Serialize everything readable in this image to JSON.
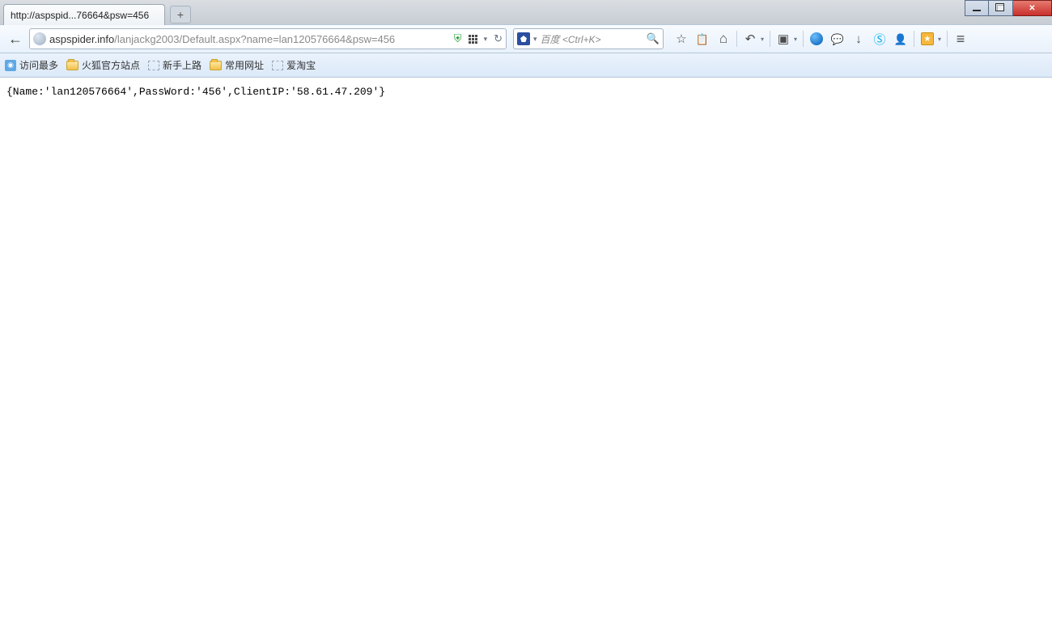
{
  "window": {
    "tab_title": "http://aspspid...76664&psw=456"
  },
  "url": {
    "host": "aspspider.info",
    "path": "/lanjackg2003/Default.aspx?name=lan120576664&psw=456"
  },
  "search": {
    "placeholder": "百度 <Ctrl+K>"
  },
  "bookmarks": {
    "items": [
      {
        "label": "访问最多",
        "icon": "feed"
      },
      {
        "label": "火狐官方站点",
        "icon": "folder"
      },
      {
        "label": "新手上路",
        "icon": "dashed"
      },
      {
        "label": "常用网址",
        "icon": "folder"
      },
      {
        "label": "爱淘宝",
        "icon": "dashed"
      }
    ]
  },
  "page": {
    "content": "{Name:'lan120576664',PassWord:'456',ClientIP:'58.61.47.209'}"
  }
}
